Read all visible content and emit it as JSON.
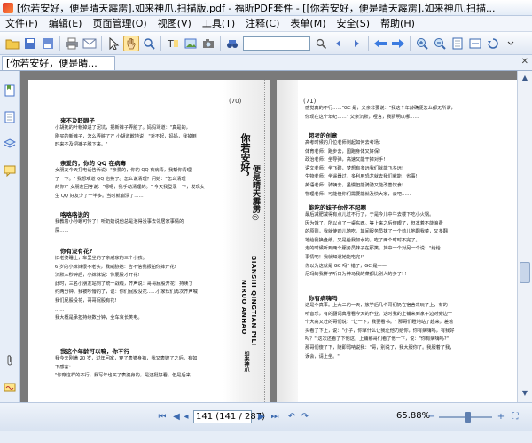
{
  "window": {
    "title": "[你若安好，便是晴天霹雳].如来神爪.扫描版.pdf - 福昕PDF套件 - [[你若安好，便是晴天霹雳].如来神爪.扫描..."
  },
  "menu": [
    "文件(F)",
    "编辑(E)",
    "页面管理(O)",
    "视图(V)",
    "工具(T)",
    "注释(C)",
    "表单(M)",
    "安全(S)",
    "帮助(H)"
  ],
  "toolbar_icons": [
    "open-folder-icon",
    "save-icon",
    "save-as-icon",
    "print-icon",
    "email-icon",
    "select-text-icon",
    "hand-tool-icon",
    "snapshot-icon",
    "text-select-icon",
    "image-icon",
    "camera-icon",
    "find-icon",
    "search-options-icon",
    "previous-icon",
    "next-icon",
    "back-arrow-icon",
    "forward-arrow-icon",
    "zoom-in-icon",
    "zoom-out-icon",
    "fit-page-icon",
    "fit-width-icon",
    "rotate-icon",
    "more-icon"
  ],
  "tab": {
    "label": "[你若安好，便是晴..."
  },
  "status": {
    "page_display": "141 (141 / 287)",
    "zoom": "65.88%",
    "zoom_level": 0.55
  },
  "page_left": {
    "page_number": "(70)",
    "heading1": "来不及眨眼子",
    "para1": [
      "小胡抚的叶帐掉进了泥坑，把新裤子弄脏了。妈妈骂道：\"真是的，",
      "刚买的新裤子，怎么弄脏了?\" 小胡道歉地说：\"对不起，妈妈，我掉倒",
      "时来不及把裤子脱下来。\""
    ],
    "heading2": "亲爱的，你的 QQ 在病毒",
    "para2": [
      "女朋友今天打电话告诉说：\"亲爱的，你的 QQ 有病毒，我帮你清理",
      "了一下。\" 我想难道 QQ 也换了。怎么说清理？问她：\"怎么清理",
      "的你?\" 女朋友回答说：\"嗯嗯，我手动清理的。\" 今天我登录一下，发现女",
      "生 QQ 好友少了一半多。当时就崩溃了……"
    ],
    "heading3": "咯咯咯说的",
    "para3": [
      "我教着小孙蛾可怜了！听奶奶说他总是泡得没事去邻居家事情的",
      "屎……"
    ],
    "heading4": "你有没有花?",
    "para4": [
      "旧老婆睡上，车里坐的了亲戚家的三个小孩。",
      "6 岁的小妹妹很不老实，我威胁她：告不信我报拍你摔开花!",
      "沉默三秒钟后，小妹妹说：你屁股才开花!",
      "此时，三名小朋友站到了统一战线，齐声说：哥哥屁股开花！持续了",
      "约两分钟。我被吵懵的了，说：你们屁股没花……小家伙们再次齐声喊",
      "我们屁股没花，哥哥屁股有花!",
      "……",
      "我大概是承担持续数分钟，全车哀长笑电。"
    ],
    "heading5": "我这个年龄可以嘛，你不行",
    "para5": [
      "我今天刚满 20 岁，过年回家，穿了表婆身裤，我又表嫂了之后，有如",
      "下感言：",
      "\"你穿这样的不行，我写年也买了表婆身的，是还挺好看，但是后来"
    ],
    "vertical_title_1": "你若安好，",
    "vertical_title_2": "便是晴天霹雳◎",
    "pinyin_1": "NIRUO ANHAO",
    "pinyin_2": "BIANSHI QINGTIAN PILI",
    "author": "如来神爪"
  },
  "page_right": {
    "page_number": "(71)",
    "para1": [
      "感觉真的不行……\"GC 是，父亲非要说：\"我这个年龄确便怎么都无所谓，",
      "你现在这个年纪……\" 父亲沉默，哑言，我猜明以哪……"
    ],
    "heading1": "超考的创意",
    "list1": [
      "高考时候的几位老师剩起如何去考场：",
      "体育老师：跑步去，国跑身体又好保!",
      "政治老师：坐导弹，高速又能干掉对手!",
      "语文老师：坐飞碟，梦想有多远我们就能飞多远!",
      "生物老师：坐遥器过，多利用恐龙就去我们就能，省事!",
      "英语老师：骑辆去，虽慢但能骑骑又能改善饮食!",
      "物理老师：可能但你们需要能就及快大家，去吧……"
    ],
    "heading2": "能吃的妹子你伤不起啊",
    "para2": [
      "最后减肥减得有点儿过不行了，于是今儿中午去楼下吃小火锅。",
      "因为饿了，所以点了一桌东西。等上来之后傻眼了，但本着不能浪费",
      "的原则，我就使劲儿地吃。其间服务员抹了一个劲儿地翻我菜，又多翻",
      "地给我换盘纸，又是给我加水的，吃了两个时时不完了。",
      "走的时候听到两个服务员抹子在那笑，其中一个对另一个说：\"给给",
      "事情吧！我就知道她能吃完!\"",
      "你以为这就是 GC 吗? 错了，GC 是——",
      "尼玛的我拼子听日为神马我的菜都比别人的多了! !"
    ],
    "heading3": "你有病嗨吗",
    "para3": [
      "这是个真事。上大二的一天，放学后几个哥们奶在宿舍来玩了上，有的",
      "听音乐，有的翻词典看看今天的作业。这时我的上铺来到家子边对旁边一",
      "个大高又壮的哥们说：\"让一下，我要看书。\" 那哥们瞪地站了起来，差着",
      "头看了下上，说：\"小子，你拿什么让我让他力给你，你有病嗨吗，有我好",
      "吗？\" 这次还看了下他这，上铺那哥们看了他一下，说：\"你有病嗨吗?\"",
      "那哥们傻了下，随即弱呐说我：\"哥，别说了，我大服你了。我服着了我，",
      "误会，请上坐。\""
    ]
  }
}
